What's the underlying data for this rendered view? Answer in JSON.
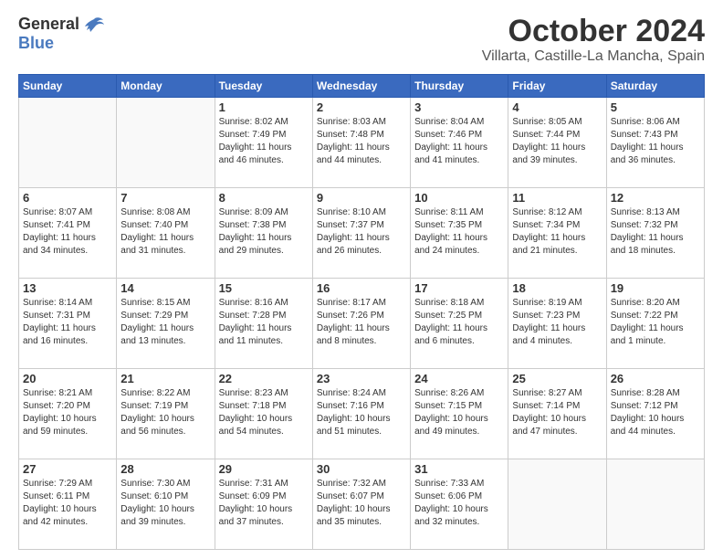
{
  "header": {
    "logo_general": "General",
    "logo_blue": "Blue",
    "month_title": "October 2024",
    "location": "Villarta, Castille-La Mancha, Spain"
  },
  "weekdays": [
    "Sunday",
    "Monday",
    "Tuesday",
    "Wednesday",
    "Thursday",
    "Friday",
    "Saturday"
  ],
  "weeks": [
    [
      {
        "day": "",
        "info": ""
      },
      {
        "day": "",
        "info": ""
      },
      {
        "day": "1",
        "info": "Sunrise: 8:02 AM\nSunset: 7:49 PM\nDaylight: 11 hours and 46 minutes."
      },
      {
        "day": "2",
        "info": "Sunrise: 8:03 AM\nSunset: 7:48 PM\nDaylight: 11 hours and 44 minutes."
      },
      {
        "day": "3",
        "info": "Sunrise: 8:04 AM\nSunset: 7:46 PM\nDaylight: 11 hours and 41 minutes."
      },
      {
        "day": "4",
        "info": "Sunrise: 8:05 AM\nSunset: 7:44 PM\nDaylight: 11 hours and 39 minutes."
      },
      {
        "day": "5",
        "info": "Sunrise: 8:06 AM\nSunset: 7:43 PM\nDaylight: 11 hours and 36 minutes."
      }
    ],
    [
      {
        "day": "6",
        "info": "Sunrise: 8:07 AM\nSunset: 7:41 PM\nDaylight: 11 hours and 34 minutes."
      },
      {
        "day": "7",
        "info": "Sunrise: 8:08 AM\nSunset: 7:40 PM\nDaylight: 11 hours and 31 minutes."
      },
      {
        "day": "8",
        "info": "Sunrise: 8:09 AM\nSunset: 7:38 PM\nDaylight: 11 hours and 29 minutes."
      },
      {
        "day": "9",
        "info": "Sunrise: 8:10 AM\nSunset: 7:37 PM\nDaylight: 11 hours and 26 minutes."
      },
      {
        "day": "10",
        "info": "Sunrise: 8:11 AM\nSunset: 7:35 PM\nDaylight: 11 hours and 24 minutes."
      },
      {
        "day": "11",
        "info": "Sunrise: 8:12 AM\nSunset: 7:34 PM\nDaylight: 11 hours and 21 minutes."
      },
      {
        "day": "12",
        "info": "Sunrise: 8:13 AM\nSunset: 7:32 PM\nDaylight: 11 hours and 18 minutes."
      }
    ],
    [
      {
        "day": "13",
        "info": "Sunrise: 8:14 AM\nSunset: 7:31 PM\nDaylight: 11 hours and 16 minutes."
      },
      {
        "day": "14",
        "info": "Sunrise: 8:15 AM\nSunset: 7:29 PM\nDaylight: 11 hours and 13 minutes."
      },
      {
        "day": "15",
        "info": "Sunrise: 8:16 AM\nSunset: 7:28 PM\nDaylight: 11 hours and 11 minutes."
      },
      {
        "day": "16",
        "info": "Sunrise: 8:17 AM\nSunset: 7:26 PM\nDaylight: 11 hours and 8 minutes."
      },
      {
        "day": "17",
        "info": "Sunrise: 8:18 AM\nSunset: 7:25 PM\nDaylight: 11 hours and 6 minutes."
      },
      {
        "day": "18",
        "info": "Sunrise: 8:19 AM\nSunset: 7:23 PM\nDaylight: 11 hours and 4 minutes."
      },
      {
        "day": "19",
        "info": "Sunrise: 8:20 AM\nSunset: 7:22 PM\nDaylight: 11 hours and 1 minute."
      }
    ],
    [
      {
        "day": "20",
        "info": "Sunrise: 8:21 AM\nSunset: 7:20 PM\nDaylight: 10 hours and 59 minutes."
      },
      {
        "day": "21",
        "info": "Sunrise: 8:22 AM\nSunset: 7:19 PM\nDaylight: 10 hours and 56 minutes."
      },
      {
        "day": "22",
        "info": "Sunrise: 8:23 AM\nSunset: 7:18 PM\nDaylight: 10 hours and 54 minutes."
      },
      {
        "day": "23",
        "info": "Sunrise: 8:24 AM\nSunset: 7:16 PM\nDaylight: 10 hours and 51 minutes."
      },
      {
        "day": "24",
        "info": "Sunrise: 8:26 AM\nSunset: 7:15 PM\nDaylight: 10 hours and 49 minutes."
      },
      {
        "day": "25",
        "info": "Sunrise: 8:27 AM\nSunset: 7:14 PM\nDaylight: 10 hours and 47 minutes."
      },
      {
        "day": "26",
        "info": "Sunrise: 8:28 AM\nSunset: 7:12 PM\nDaylight: 10 hours and 44 minutes."
      }
    ],
    [
      {
        "day": "27",
        "info": "Sunrise: 7:29 AM\nSunset: 6:11 PM\nDaylight: 10 hours and 42 minutes."
      },
      {
        "day": "28",
        "info": "Sunrise: 7:30 AM\nSunset: 6:10 PM\nDaylight: 10 hours and 39 minutes."
      },
      {
        "day": "29",
        "info": "Sunrise: 7:31 AM\nSunset: 6:09 PM\nDaylight: 10 hours and 37 minutes."
      },
      {
        "day": "30",
        "info": "Sunrise: 7:32 AM\nSunset: 6:07 PM\nDaylight: 10 hours and 35 minutes."
      },
      {
        "day": "31",
        "info": "Sunrise: 7:33 AM\nSunset: 6:06 PM\nDaylight: 10 hours and 32 minutes."
      },
      {
        "day": "",
        "info": ""
      },
      {
        "day": "",
        "info": ""
      }
    ]
  ]
}
